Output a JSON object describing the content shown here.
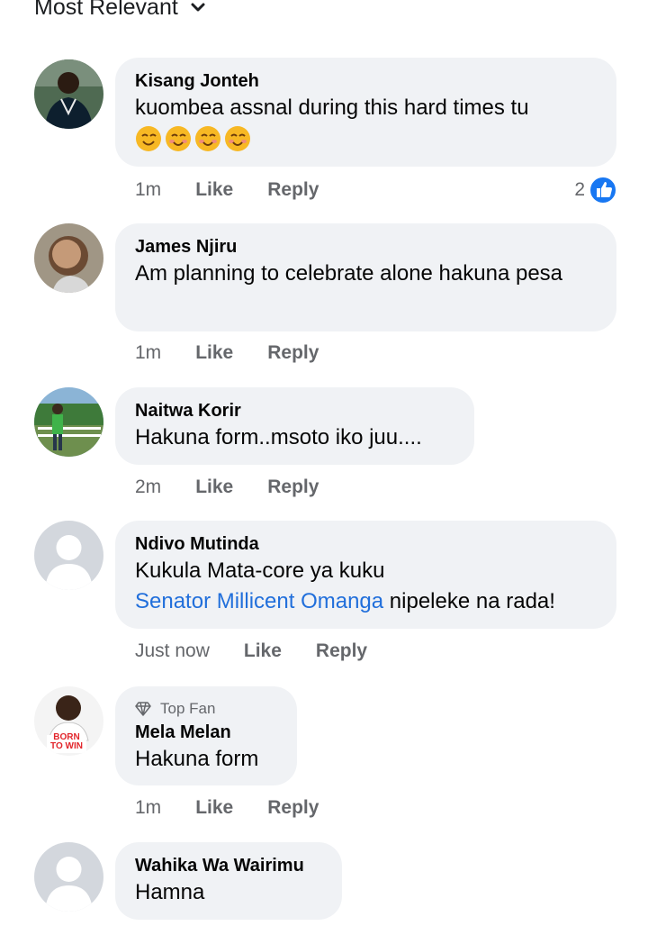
{
  "sort": {
    "label": "Most Relevant"
  },
  "comments": [
    {
      "author": "Kisang Jonteh",
      "text": "kuombea assnal during this hard times tu",
      "emojis": [
        "☺",
        "☺",
        "☺",
        "☺"
      ],
      "time": "1m",
      "like": "Like",
      "reply": "Reply",
      "reaction_count": "2"
    },
    {
      "author": "James Njiru",
      "text": "Am planning to celebrate alone hakuna pesa",
      "time": "1m",
      "like": "Like",
      "reply": "Reply"
    },
    {
      "author": "Naitwa Korir",
      "text": "Hakuna form..msoto iko juu....",
      "time": "2m",
      "like": "Like",
      "reply": "Reply"
    },
    {
      "author": "Ndivo Mutinda",
      "text": "Kukula Mata-core ya kuku",
      "mention": "Senator Millicent Omanga",
      "text_after_mention": " nipeleke na rada!",
      "time": "Just now",
      "like": "Like",
      "reply": "Reply"
    },
    {
      "badge": "Top Fan",
      "author": "Mela Melan",
      "avatar_text": "BORN TO WIN",
      "text": "Hakuna form",
      "time": "1m",
      "like": "Like",
      "reply": "Reply"
    },
    {
      "author": "Wahika Wa Wairimu",
      "text": "Hamna"
    }
  ],
  "colors": {
    "bubble": "#f0f2f5",
    "meta": "#65676b",
    "link": "#216fdb",
    "like_blue": "#1877f2"
  }
}
